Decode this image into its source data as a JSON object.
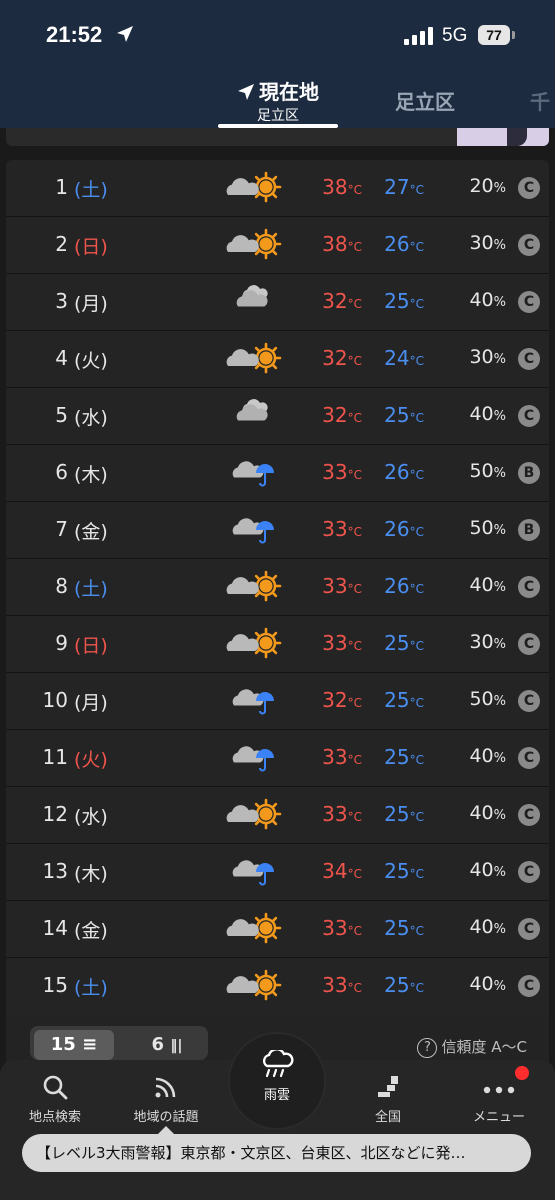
{
  "status": {
    "time": "21:52",
    "network": "5G",
    "battery": "77"
  },
  "tabs": {
    "current_title": "現在地",
    "current_sub": "足立区",
    "second": "足立区",
    "third": "千"
  },
  "forecast": [
    {
      "day": "1",
      "dow": "(土)",
      "type": "sat",
      "icon": "cloud-sun",
      "max": "38",
      "min": "27",
      "pop": "20",
      "rel": "C"
    },
    {
      "day": "2",
      "dow": "(日)",
      "type": "sun",
      "icon": "cloud-sun",
      "max": "38",
      "min": "26",
      "pop": "30",
      "rel": "C"
    },
    {
      "day": "3",
      "dow": "(月)",
      "type": "wk",
      "icon": "cloud",
      "max": "32",
      "min": "25",
      "pop": "40",
      "rel": "C"
    },
    {
      "day": "4",
      "dow": "(火)",
      "type": "wk",
      "icon": "cloud-sun",
      "max": "32",
      "min": "24",
      "pop": "30",
      "rel": "C"
    },
    {
      "day": "5",
      "dow": "(水)",
      "type": "wk",
      "icon": "cloud",
      "max": "32",
      "min": "25",
      "pop": "40",
      "rel": "C"
    },
    {
      "day": "6",
      "dow": "(木)",
      "type": "wk",
      "icon": "cloud-umbrella",
      "max": "33",
      "min": "26",
      "pop": "50",
      "rel": "B"
    },
    {
      "day": "7",
      "dow": "(金)",
      "type": "wk",
      "icon": "cloud-umbrella",
      "max": "33",
      "min": "26",
      "pop": "50",
      "rel": "B"
    },
    {
      "day": "8",
      "dow": "(土)",
      "type": "sat",
      "icon": "cloud-sun",
      "max": "33",
      "min": "26",
      "pop": "40",
      "rel": "C"
    },
    {
      "day": "9",
      "dow": "(日)",
      "type": "sun",
      "icon": "cloud-sun",
      "max": "33",
      "min": "25",
      "pop": "30",
      "rel": "C"
    },
    {
      "day": "10",
      "dow": "(月)",
      "type": "wk",
      "icon": "cloud-umbrella",
      "max": "32",
      "min": "25",
      "pop": "50",
      "rel": "C"
    },
    {
      "day": "11",
      "dow": "(火)",
      "type": "sun",
      "icon": "cloud-umbrella",
      "max": "33",
      "min": "25",
      "pop": "40",
      "rel": "C"
    },
    {
      "day": "12",
      "dow": "(水)",
      "type": "wk",
      "icon": "cloud-sun",
      "max": "33",
      "min": "25",
      "pop": "40",
      "rel": "C"
    },
    {
      "day": "13",
      "dow": "(木)",
      "type": "wk",
      "icon": "cloud-umbrella",
      "max": "34",
      "min": "25",
      "pop": "40",
      "rel": "C"
    },
    {
      "day": "14",
      "dow": "(金)",
      "type": "wk",
      "icon": "cloud-sun",
      "max": "33",
      "min": "25",
      "pop": "40",
      "rel": "C"
    },
    {
      "day": "15",
      "dow": "(土)",
      "type": "sat",
      "icon": "cloud-sun",
      "max": "33",
      "min": "25",
      "pop": "40",
      "rel": "C"
    }
  ],
  "units": {
    "temp": "°C",
    "pct": "%"
  },
  "controls": {
    "toggle_on": "15",
    "toggle_off": "6",
    "reliability_note": "信頼度 A〜C"
  },
  "tabbar": {
    "search": "地点検索",
    "topics": "地域の話題",
    "rain": "雨雲",
    "nation": "全国",
    "menu": "メニュー"
  },
  "ticker": "【レベル3大雨警報】東京都・文京区、台東区、北区などに発…",
  "colors": {
    "header": "#1c2b3f",
    "max": "#f0554d",
    "min": "#4a8ef0",
    "sun": "#f39a1d"
  }
}
